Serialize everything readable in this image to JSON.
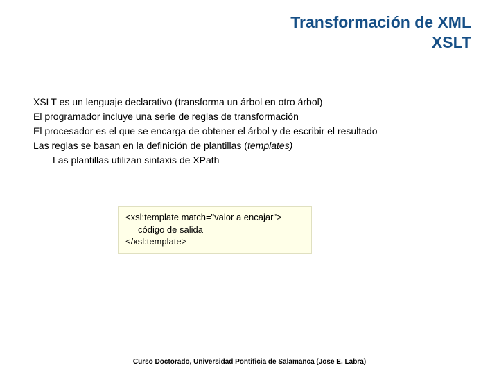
{
  "title": {
    "line1": "Transformación de XML",
    "line2": "XSLT"
  },
  "body": {
    "p1": "XSLT es un lenguaje declarativo (transforma un árbol en otro árbol)",
    "p2": "El programador incluye una serie de reglas de transformación",
    "p3": "El procesador es el que se encarga de obtener el árbol y de escribir el resultado",
    "p4_prefix": "Las reglas se basan en la definición de plantillas (",
    "p4_italic": "templates)",
    "p5": "Las plantillas utilizan sintaxis de XPath"
  },
  "code": {
    "l1": "<xsl:template match=\"valor a encajar\">",
    "l2": "código de salida",
    "l3": "</xsl:template>"
  },
  "footer": "Curso Doctorado, Universidad Pontificia de Salamanca (Jose E. Labra)"
}
